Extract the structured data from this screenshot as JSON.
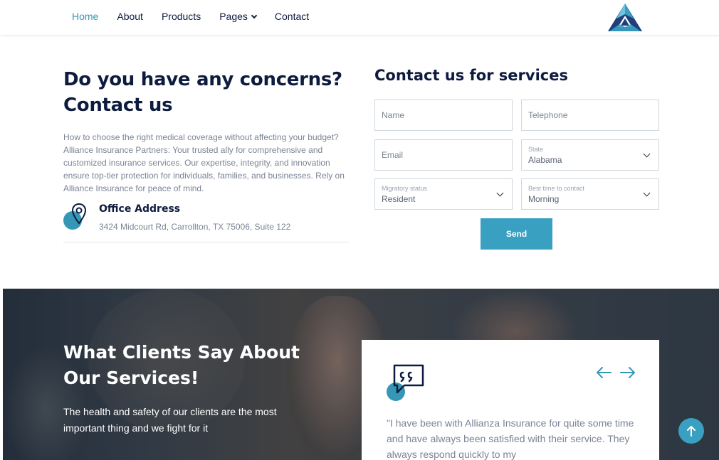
{
  "nav": {
    "items": [
      {
        "label": "Home",
        "active": true
      },
      {
        "label": "About"
      },
      {
        "label": "Products"
      },
      {
        "label": "Pages",
        "dropdown": true
      },
      {
        "label": "Contact"
      }
    ],
    "logo_icon": "triangle-logo-icon"
  },
  "concerns": {
    "title_line1": "Do you have any concerns?",
    "title_line2": "Contact us",
    "description": "How to choose the right medical coverage without affecting your budget? Alliance Insurance Partners: Your trusted ally for comprehensive and customized insurance services. Our expertise, integrity, and innovation ensure top-tier protection for individuals, families, and businesses. Rely on Alliance Insurance for peace of mind.",
    "office_title": "Office Address",
    "office_address": "3424 Midcourt Rd, Carrollton, TX 75006, Suite 122"
  },
  "form": {
    "title": "Contact us for services",
    "name_placeholder": "Name",
    "telephone_placeholder": "Telephone",
    "email_placeholder": "Email",
    "state_label": "State",
    "state_value": "Alabama",
    "migratory_label": "Migratory status",
    "migratory_value": "Resident",
    "time_label": "Best time to contact",
    "time_value": "Morning",
    "send_label": "Send"
  },
  "testimonials": {
    "title_line1": "What Clients Say About",
    "title_line2": "Our Services!",
    "subtitle": "The health and safety of our clients are the most important thing and we fight for it",
    "quote": "\"I have been with Allianza Insurance for quite some time and have always been satisfied with their service. They always respond quickly to my",
    "prev_icon": "arrow-left-icon",
    "next_icon": "arrow-right-icon"
  },
  "colors": {
    "accent": "#3596b5",
    "navy": "#0d1b3e",
    "muted": "#7a8494"
  }
}
